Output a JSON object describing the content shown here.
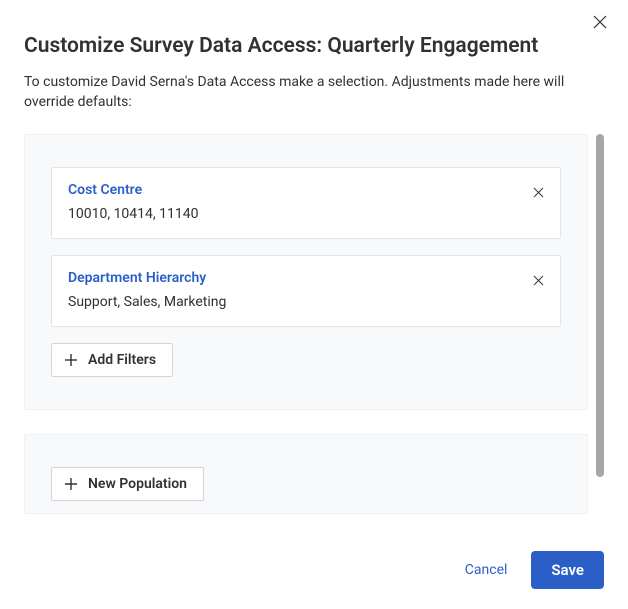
{
  "dialog": {
    "title": "Customize Survey Data Access: Quarterly Engagement",
    "subtitle": "To customize David Serna's Data Access make a selection. Adjustments made here will override defaults:"
  },
  "filters": [
    {
      "label": "Cost Centre",
      "values": "10010, 10414, 11140"
    },
    {
      "label": "Department Hierarchy",
      "values": "Support, Sales, Marketing"
    }
  ],
  "buttons": {
    "add_filters": "Add Filters",
    "new_population": "New Population",
    "cancel": "Cancel",
    "save": "Save"
  },
  "icons": {
    "close": "close-icon",
    "remove": "close-icon",
    "plus": "plus-icon"
  }
}
